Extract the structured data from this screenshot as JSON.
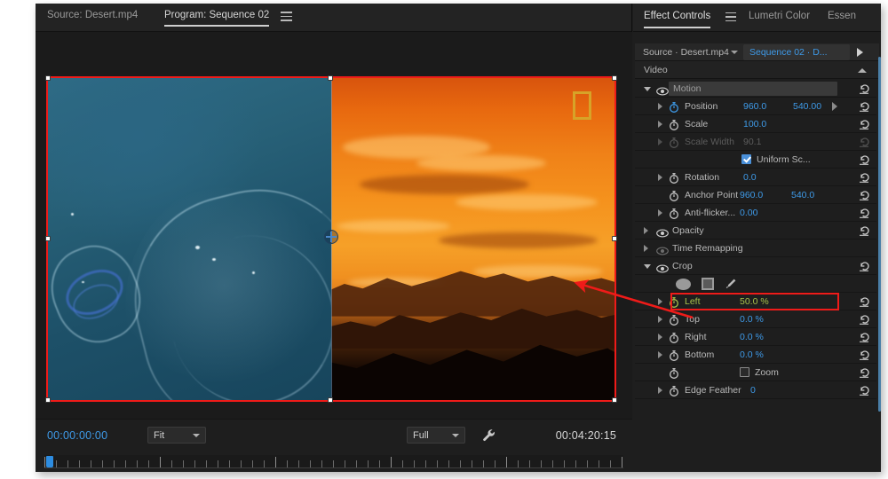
{
  "monitor": {
    "tabs": {
      "source_label": "Source: Desert.mp4",
      "program_label": "Program: Sequence 02",
      "menu_icon": "hamburger-menu-icon"
    },
    "bottom": {
      "current_timecode": "00:00:00:00",
      "zoom_level": "Fit",
      "playback_resolution": "Full",
      "duration_timecode": "00:04:20:15",
      "settings_icon": "wrench-icon"
    },
    "overlay": {
      "logo_shape": "gold-rectangle-outline",
      "center_marker": "anchor-point-crosshair-icon"
    }
  },
  "effect_controls": {
    "tabs": [
      {
        "label": "Effect Controls",
        "active": true
      },
      {
        "label": "Lumetri Color",
        "active": false
      },
      {
        "label": "Essen",
        "active": false
      }
    ],
    "panel_menu_icon": "hamburger-menu-icon",
    "clip_bar": {
      "source_label": "Source · Desert.mp4",
      "sequence_label": "Sequence 02 · D...",
      "dropdown_icon": "chevron-down-icon",
      "play_icon": "play-triangle-icon"
    },
    "section_header": {
      "label": "Video",
      "collapse_icon": "chevron-up-icon"
    },
    "groups": [
      {
        "name": "Motion",
        "expanded": true,
        "eye_icon": "eye-icon",
        "reset_icon": "reset-icon",
        "properties": [
          {
            "label": "Position",
            "values": [
              "960.0",
              "540.00"
            ],
            "keyframed": true,
            "has_twisty": true,
            "has_keyframe_nav": true,
            "reset_icon": "reset-icon"
          },
          {
            "label": "Scale",
            "values": [
              "100.0"
            ],
            "keyframed": false,
            "has_twisty": true,
            "reset_icon": "reset-icon"
          },
          {
            "label": "Scale Width",
            "values": [
              "90.1"
            ],
            "keyframed": false,
            "has_twisty": true,
            "disabled": true,
            "reset_icon": "reset-icon"
          },
          {
            "label": "Uniform Sc...",
            "type": "checkbox",
            "checked": true,
            "reset_icon": "reset-icon"
          },
          {
            "label": "Rotation",
            "values": [
              "0.0"
            ],
            "keyframed": false,
            "has_twisty": true,
            "reset_icon": "reset-icon"
          },
          {
            "label": "Anchor Point",
            "values": [
              "960.0",
              "540.0"
            ],
            "keyframed": false,
            "has_twisty": false,
            "reset_icon": "reset-icon"
          },
          {
            "label": "Anti-flicker...",
            "values": [
              "0.00"
            ],
            "keyframed": false,
            "has_twisty": true,
            "reset_icon": "reset-icon"
          }
        ]
      },
      {
        "name": "Opacity",
        "expanded": false,
        "eye_icon": "eye-icon",
        "reset_icon": "reset-icon",
        "properties": []
      },
      {
        "name": "Time Remapping",
        "expanded": false,
        "eye_icon": "eye-icon-dim",
        "properties": []
      },
      {
        "name": "Crop",
        "expanded": true,
        "eye_icon": "eye-icon",
        "reset_icon": "reset-icon",
        "mask_tools": [
          "ellipse-mask-icon",
          "rectangle-mask-icon",
          "pen-mask-icon"
        ],
        "properties": [
          {
            "label": "Left",
            "values": [
              "50.0 %"
            ],
            "highlighted": true,
            "has_twisty": true,
            "reset_icon": "reset-icon"
          },
          {
            "label": "Top",
            "values": [
              "0.0 %"
            ],
            "has_twisty": true,
            "reset_icon": "reset-icon"
          },
          {
            "label": "Right",
            "values": [
              "0.0 %"
            ],
            "has_twisty": true,
            "reset_icon": "reset-icon"
          },
          {
            "label": "Bottom",
            "values": [
              "0.0 %"
            ],
            "has_twisty": true,
            "reset_icon": "reset-icon"
          },
          {
            "label": "Zoom",
            "type": "checkbox",
            "checked": false,
            "reset_icon": "reset-icon"
          },
          {
            "label": "Edge Feather",
            "values": [
              "0"
            ],
            "has_twisty": true,
            "reset_icon": "reset-icon"
          }
        ]
      }
    ]
  },
  "annotation": {
    "highlight_color": "#ef1b19",
    "arrow_name": "red-annotation-arrow",
    "highlight_label": "crop-left-highlight"
  },
  "colors": {
    "accent_blue": "#3e9ae8",
    "highlight_red": "#ef1b19",
    "active_value_green": "#a8c24a",
    "panel_bg": "#1e1e1e"
  }
}
